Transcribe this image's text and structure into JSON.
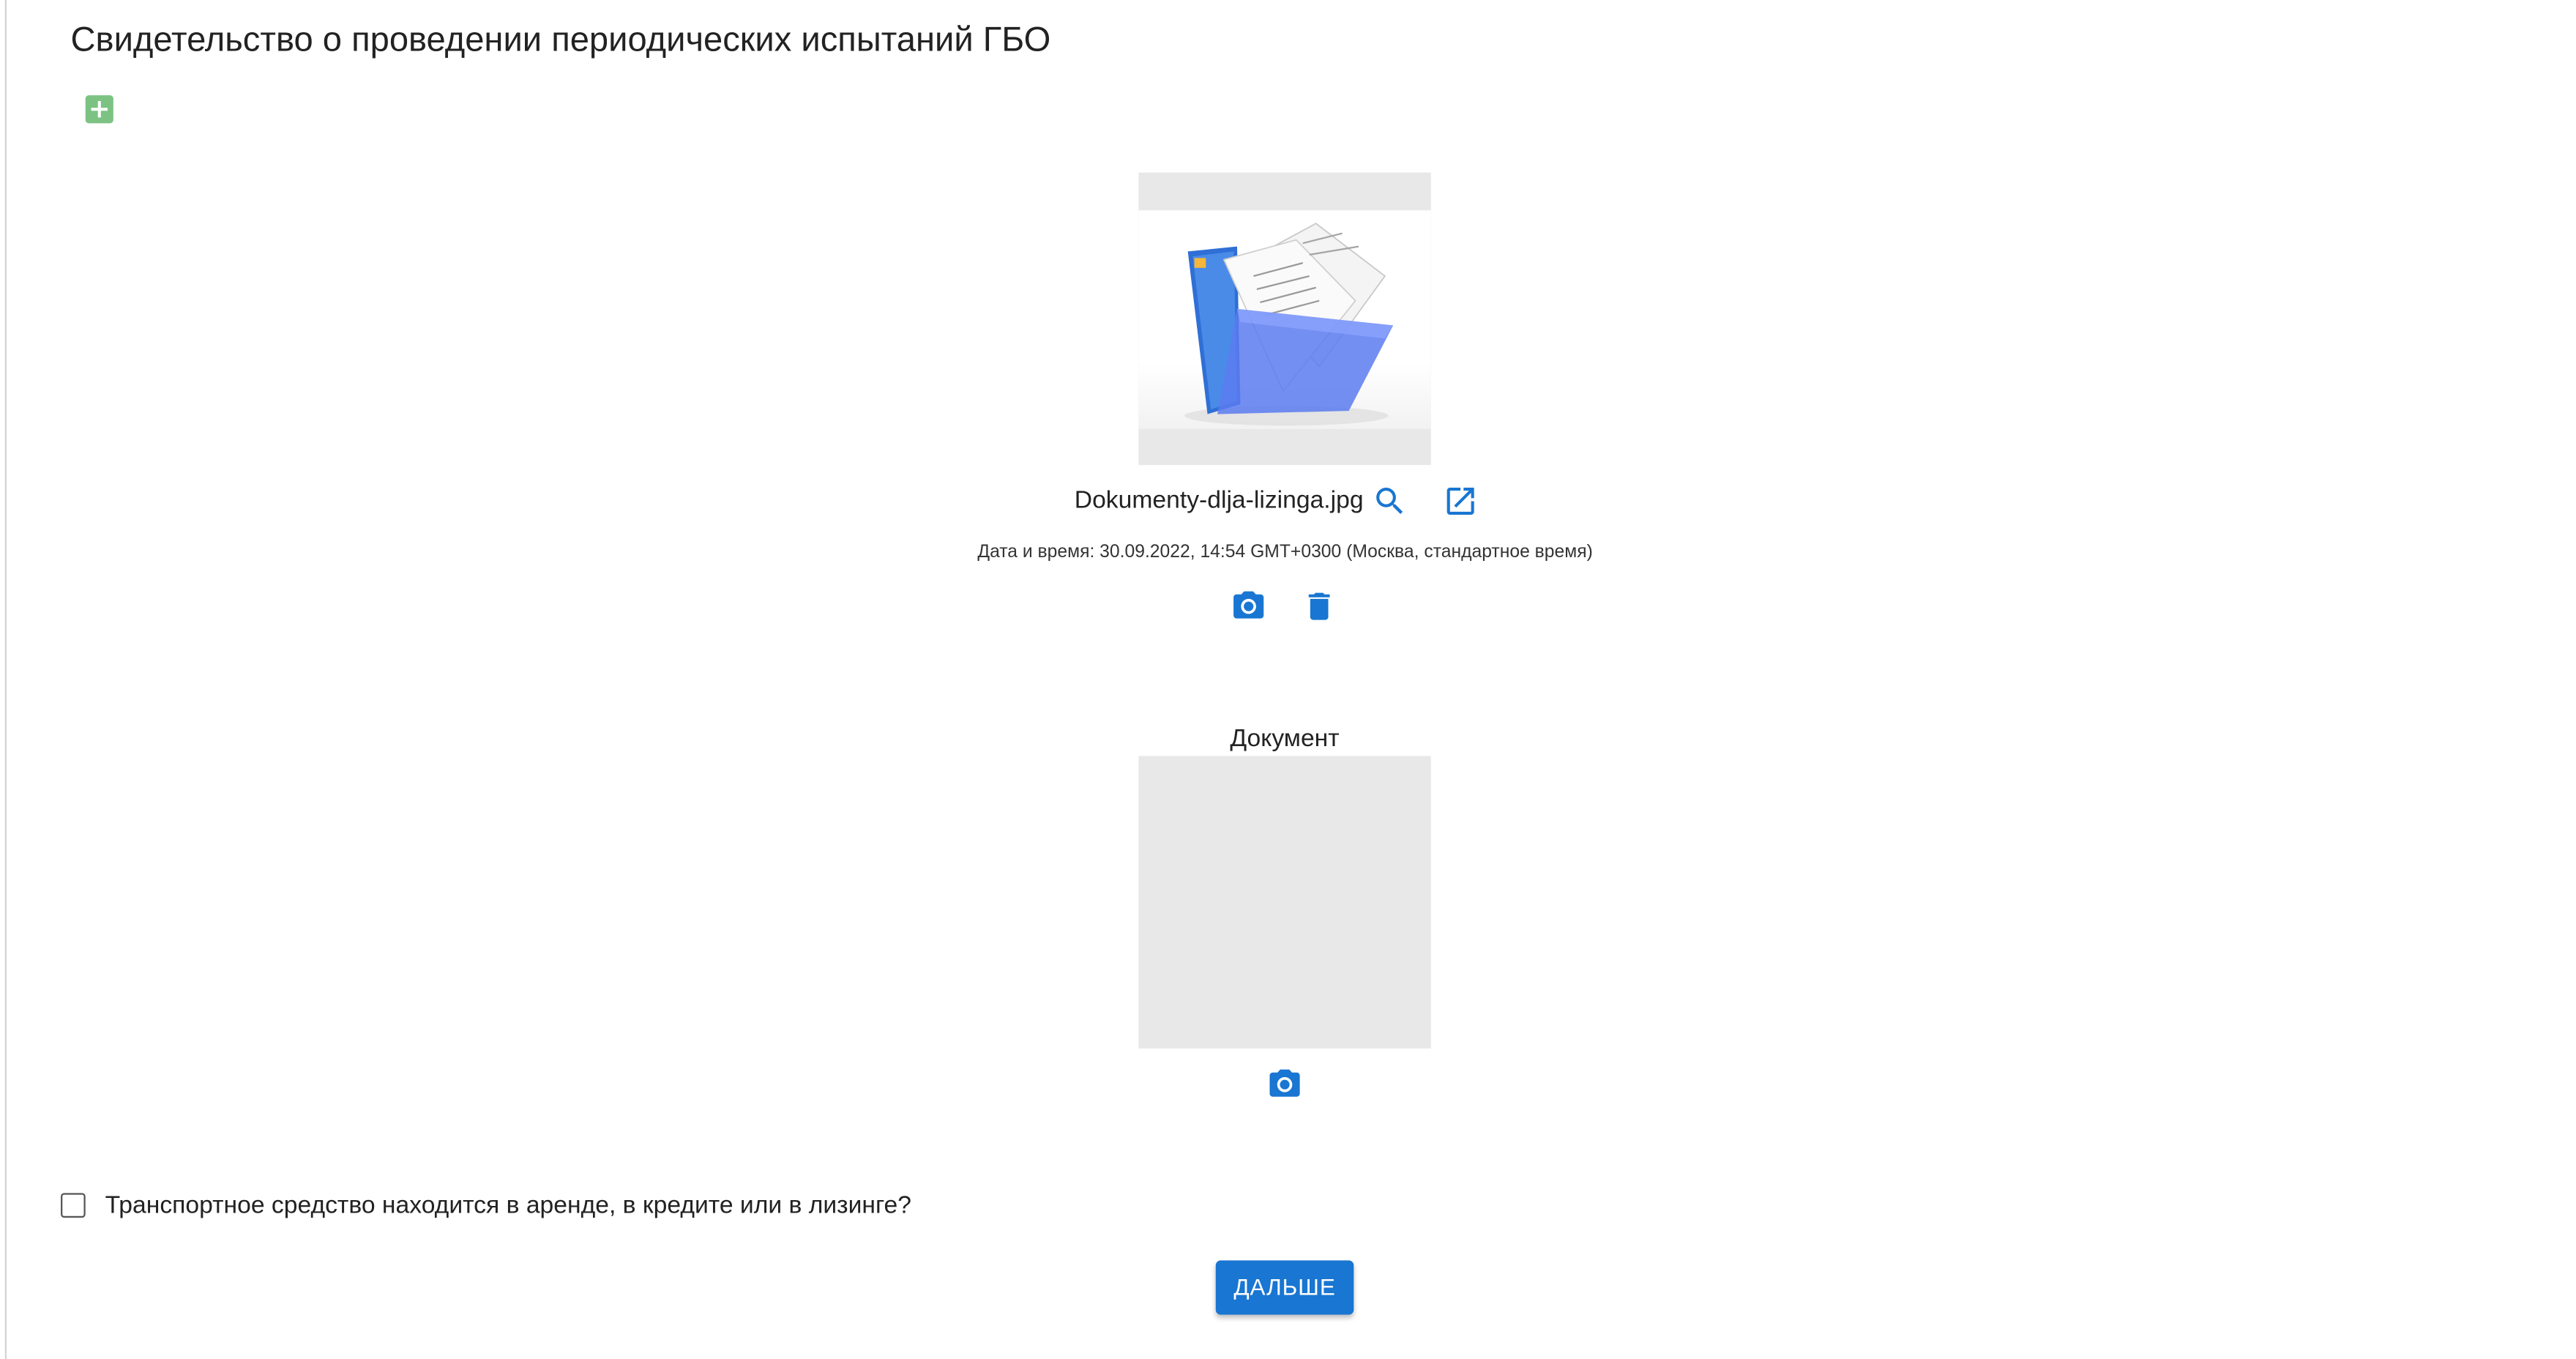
{
  "page": {
    "title": "Свидетельство о проведении периодических испытаний ГБО"
  },
  "uploaded_file": {
    "file_name": "Dokumenty-dlja-lizinga.jpg",
    "timestamp_label": "Дата и время: 30.09.2022, 14:54 GMT+0300 (Москва, стандартное время)"
  },
  "document_slot": {
    "label": "Документ"
  },
  "leasing_checkbox": {
    "label": "Транспортное средство находится в аренде, в кредите или в лизинге?",
    "checked": false
  },
  "actions": {
    "next_label": "ДАЛЬШЕ"
  },
  "icons": {
    "add": "add-box-icon",
    "zoom": "search-icon",
    "open": "open-in-new-icon",
    "camera": "camera-icon",
    "delete": "trash-icon"
  },
  "colors": {
    "accent": "#1976d2",
    "add_green": "#7cc383",
    "placeholder_gray": "#e8e8e8"
  }
}
